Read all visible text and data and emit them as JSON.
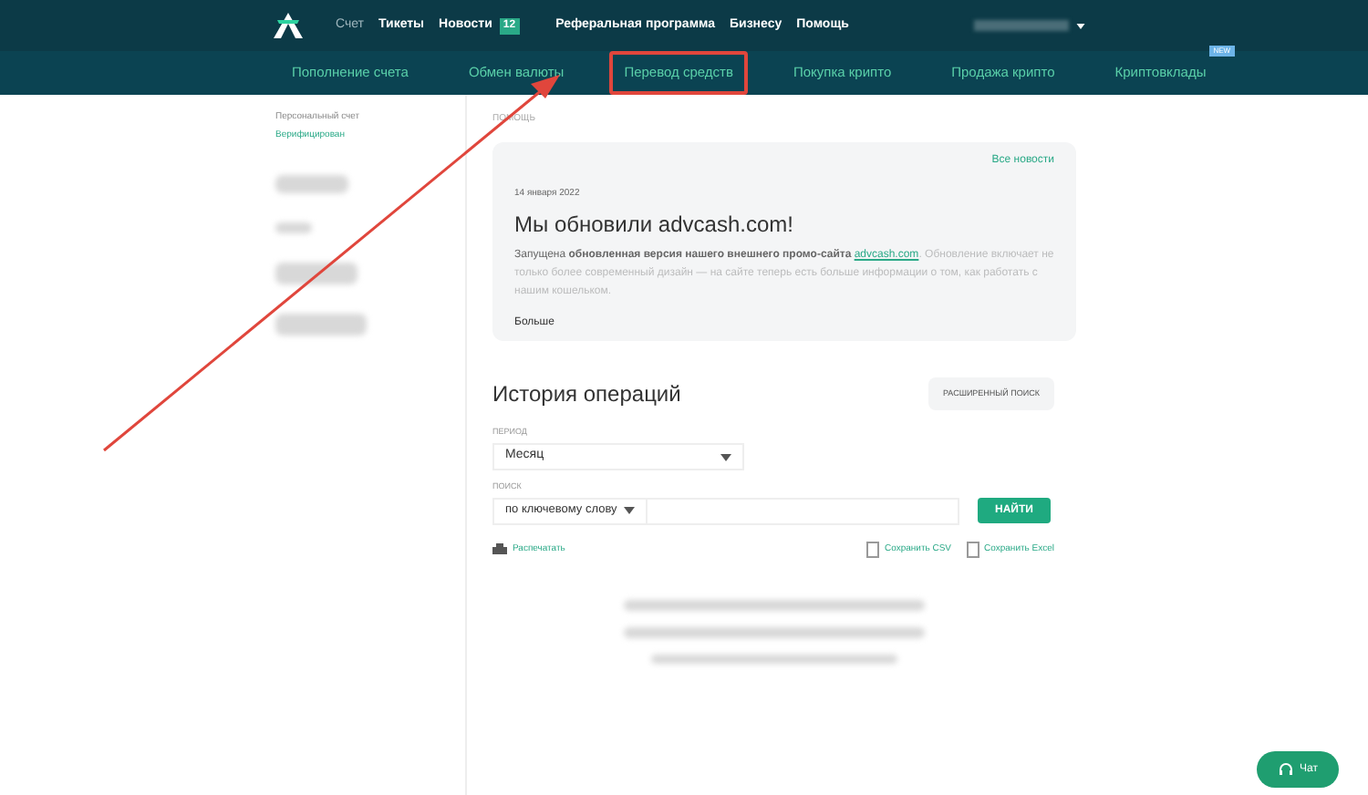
{
  "top_nav": {
    "links": [
      {
        "label": "Счет",
        "selected": false
      },
      {
        "label": "Тикеты",
        "selected": true
      },
      {
        "label": "Новости",
        "selected": true,
        "badge": "12"
      }
    ],
    "links_right": [
      "Реферальная программа",
      "Бизнесу",
      "Помощь"
    ]
  },
  "sub_nav": [
    {
      "label": "Пополнение счета",
      "highlighted": false
    },
    {
      "label": "Обмен валюты",
      "highlighted": false
    },
    {
      "label": "Перевод средств",
      "highlighted": true
    },
    {
      "label": "Покупка крипто",
      "highlighted": false
    },
    {
      "label": "Продажа крипто",
      "highlighted": false
    },
    {
      "label": "Криптовклады",
      "highlighted": false,
      "badge": "NEW"
    }
  ],
  "sidebar": {
    "account_label": "Персональный счет",
    "status": "Верифицирован"
  },
  "news": {
    "section_label": "ПОМОЩЬ",
    "all_link": "Все новости",
    "date": "14 января 2022",
    "title": "Мы обновили advcash.com!",
    "body": "Запущена **обновленная версия нашего внешнего промо-сайта** ",
    "link": "advcash.com",
    "body_after": ". Обновление включает не только более современный дизайн — на сайте теперь есть больше информации о том, как работать с нашим кошельком.",
    "more": "Больше"
  },
  "history": {
    "title": "История операций",
    "advanced_button": "РАСШИРЕННЫЙ ПОИСК",
    "period_label": "ПЕРИОД",
    "period_value": "Месяц",
    "search_label": "ПОИСК",
    "search_type": "по ключевому слову",
    "find_button": "НАЙТИ",
    "print": "Распечатать",
    "save_csv": "Сохранить CSV",
    "save_excel": "Сохранить Excel"
  },
  "chat_button": "Чат"
}
